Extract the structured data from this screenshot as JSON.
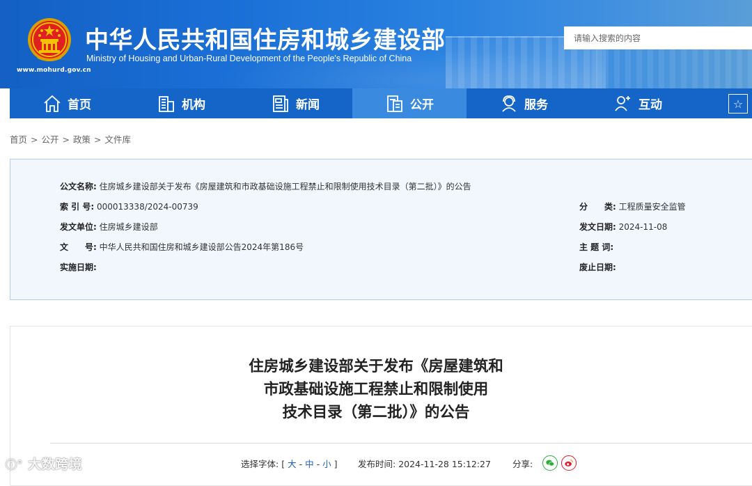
{
  "header": {
    "title": "中华人民共和国住房和城乡建设部",
    "subtitle": "Ministry of Housing and Urban-Rural Development of the People's Republic of China",
    "url": "www.mohurd.gov.cn",
    "search_placeholder": "请输入搜索的内容"
  },
  "nav": {
    "items": [
      {
        "label": "首页",
        "icon": "home-icon"
      },
      {
        "label": "机构",
        "icon": "building-icon"
      },
      {
        "label": "新闻",
        "icon": "news-icon"
      },
      {
        "label": "公开",
        "icon": "document-icon",
        "active": true
      },
      {
        "label": "服务",
        "icon": "service-icon"
      },
      {
        "label": "互动",
        "icon": "interact-icon"
      }
    ],
    "extra_icon": "star-icon"
  },
  "breadcrumb": [
    "首页",
    "公开",
    "政策",
    "文件库"
  ],
  "info": {
    "doc_name_label": "公文名称:",
    "doc_name": "住房城乡建设部关于发布《房屋建筑和市政基础设施工程禁止和限制使用技术目录（第二批）》的公告",
    "index_label": "索 引 号:",
    "index": "000013338/2024-00739",
    "category_label": "分　　类:",
    "category": "工程质量安全监管",
    "issuer_label": "发文单位:",
    "issuer": "住房城乡建设部",
    "issue_date_label": "发文日期:",
    "issue_date": "2024-11-08",
    "doc_no_label": "文　　号:",
    "doc_no": "中华人民共和国住房和城乡建设部公告2024年第186号",
    "keywords_label": "主 题 词:",
    "keywords": "",
    "effective_label": "实施日期:",
    "effective": "",
    "abolish_label": "废止日期:",
    "abolish": ""
  },
  "article": {
    "title_lines": [
      "住房城乡建设部关于发布《房屋建筑和",
      "市政基础设施工程禁止和限制使用",
      "技术目录（第二批）》的公告"
    ],
    "font_label": "选择字体:",
    "font_open": "[",
    "font_large": "大",
    "font_medium": "中",
    "font_small": "小",
    "font_close": "]",
    "publish_label": "发布时间:",
    "publish_time": "2024-11-28 15:12:27",
    "share_label": "分享:"
  },
  "watermark": "大数跨境",
  "colors": {
    "header_blue": "#1565c8",
    "nav_active": "#3a8ae0",
    "infobox_bg": "#f2f7fd",
    "wechat_green": "#2aae3a",
    "weibo_red": "#e6162d"
  }
}
